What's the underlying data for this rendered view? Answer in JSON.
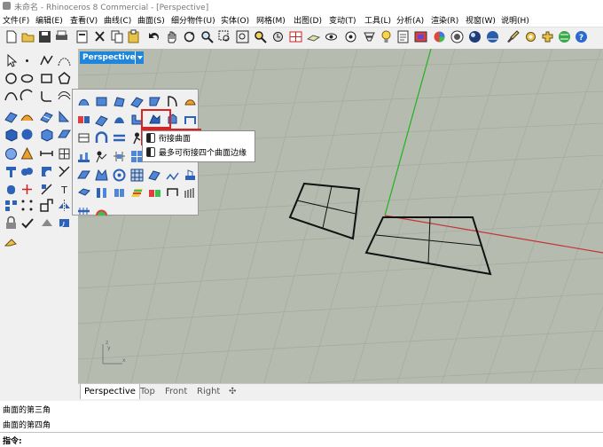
{
  "window": {
    "title": "未命名 - Rhinoceros 8 Commercial - [Perspective]"
  },
  "menus": [
    "文件(F)",
    "编辑(E)",
    "查看(V)",
    "曲线(C)",
    "曲面(S)",
    "细分物件(U)",
    "实体(O)",
    "网格(M)",
    "出图(D)",
    "变动(T)",
    "工具(L)",
    "分析(A)",
    "渲染(R)",
    "视窗(W)",
    "说明(H)"
  ],
  "viewport": {
    "name": "Perspective",
    "axis_x": "x",
    "axis_y": "y",
    "axis_z": "z"
  },
  "tooltip": {
    "title": "衔接曲面",
    "subtitle": "最多可衔接四个曲面边缘"
  },
  "tabs": [
    "Perspective",
    "Top",
    "Front",
    "Right"
  ],
  "history": [
    "曲面的第三角",
    "曲面的第四角"
  ],
  "command": {
    "label": "指令:"
  },
  "colors": {
    "accent": "#1e86dc",
    "highlight": "#e02020",
    "viewport_bg": "#b6bbb0",
    "grid": "#a4aa9e"
  }
}
